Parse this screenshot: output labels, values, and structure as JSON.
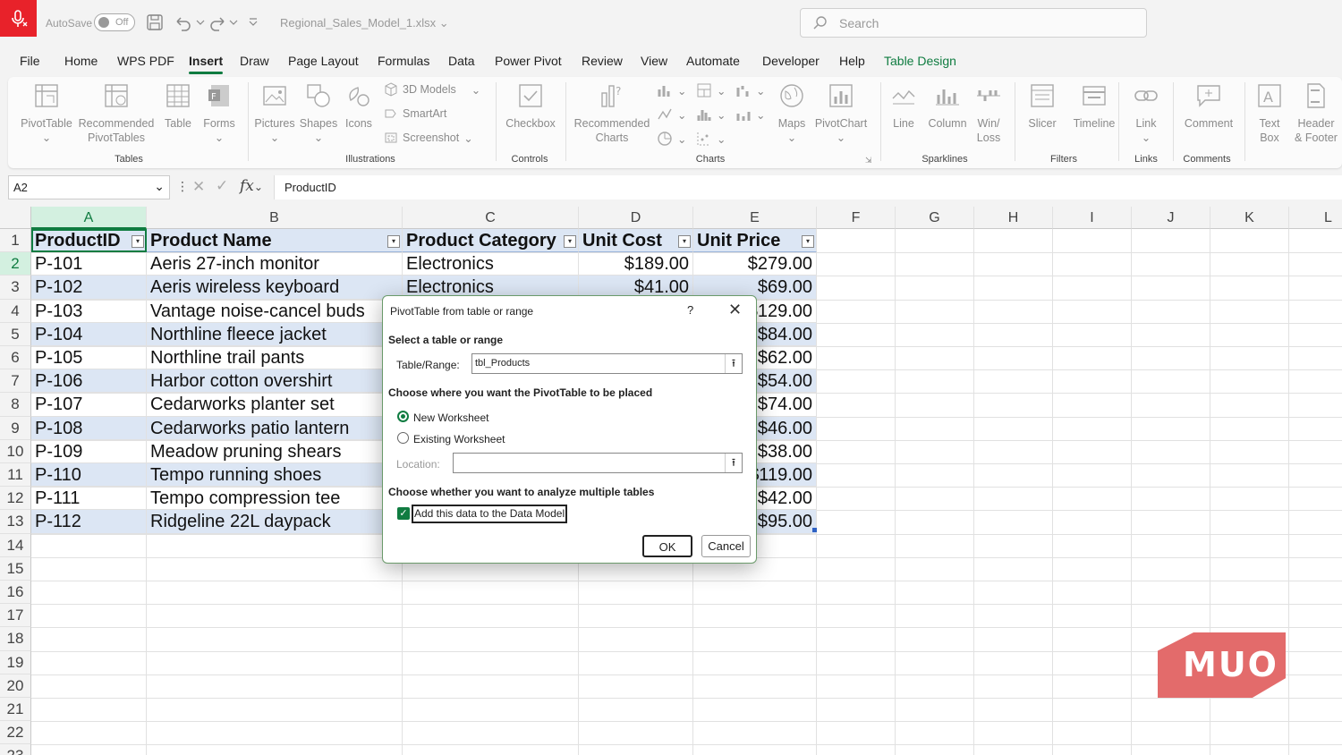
{
  "titlebar": {
    "autosave_label": "AutoSave",
    "autosave_state": "Off",
    "filename": "Regional_Sales_Model_1.xlsx",
    "search_placeholder": "Search"
  },
  "menu": [
    "File",
    "Home",
    "WPS PDF",
    "Insert",
    "Draw",
    "Page Layout",
    "Formulas",
    "Data",
    "Power Pivot",
    "Review",
    "View",
    "Automate",
    "Developer",
    "Help",
    "Table Design"
  ],
  "ribbon": {
    "pivottable": "PivotTable",
    "recommended_pivot": [
      "Recommended",
      "PivotTables"
    ],
    "table": "Table",
    "forms": "Forms",
    "group_tables": "Tables",
    "pictures": "Pictures",
    "shapes": "Shapes",
    "icons": "Icons",
    "models3d": "3D Models",
    "smartart": "SmartArt",
    "screenshot": "Screenshot",
    "group_illustrations": "Illustrations",
    "checkbox": "Checkbox",
    "group_controls": "Controls",
    "recommended_charts": [
      "Recommended",
      "Charts"
    ],
    "maps": "Maps",
    "pivotchart": "PivotChart",
    "group_charts": "Charts",
    "line": "Line",
    "column": "Column",
    "winloss": [
      "Win/",
      "Loss"
    ],
    "group_sparklines": "Sparklines",
    "slicer": "Slicer",
    "timeline": "Timeline",
    "group_filters": "Filters",
    "link": "Link",
    "group_links": "Links",
    "comment": "Comment",
    "group_comments": "Comments",
    "textbox": [
      "Text",
      "Box"
    ],
    "headerfooter": [
      "Header",
      "& Footer"
    ]
  },
  "formula": {
    "namebox": "A2",
    "value": "ProductID"
  },
  "columns": [
    "A",
    "B",
    "C",
    "D",
    "E",
    "F",
    "G",
    "H",
    "I",
    "J",
    "K",
    "L"
  ],
  "rows": [
    "1",
    "2",
    "3",
    "4",
    "5",
    "6",
    "7",
    "8",
    "9",
    "10",
    "11",
    "12",
    "13",
    "14",
    "15",
    "16",
    "17",
    "18",
    "19",
    "20",
    "21",
    "22",
    "23"
  ],
  "table": {
    "headers": [
      "ProductID",
      "Product Name",
      "Product Category",
      "Unit Cost",
      "Unit Price"
    ],
    "data": [
      [
        "P-101",
        "Aeris 27-inch monitor",
        "Electronics",
        "$189.00",
        "$279.00"
      ],
      [
        "P-102",
        "Aeris wireless keyboard",
        "Electronics",
        "$41.00",
        "$69.00"
      ],
      [
        "P-103",
        "Vantage noise-cancel buds",
        "",
        "",
        "$129.00"
      ],
      [
        "P-104",
        "Northline fleece jacket",
        "",
        "",
        "$84.00"
      ],
      [
        "P-105",
        "Northline trail pants",
        "",
        "",
        "$62.00"
      ],
      [
        "P-106",
        "Harbor cotton overshirt",
        "",
        "",
        "$54.00"
      ],
      [
        "P-107",
        "Cedarworks planter set",
        "",
        "",
        "$74.00"
      ],
      [
        "P-108",
        "Cedarworks patio lantern",
        "",
        "",
        "$46.00"
      ],
      [
        "P-109",
        "Meadow pruning shears",
        "",
        "",
        "$38.00"
      ],
      [
        "P-110",
        "Tempo running shoes",
        "",
        "",
        "$119.00"
      ],
      [
        "P-111",
        "Tempo compression tee",
        "",
        "",
        "$42.00"
      ],
      [
        "P-112",
        "Ridgeline 22L daypack",
        "",
        "",
        "$95.00"
      ]
    ]
  },
  "dialog": {
    "title": "PivotTable from table or range",
    "help": "?",
    "close": "✕",
    "section1": "Select a table or range",
    "range_label": "Table/Range:",
    "range_value": "tbl_Products",
    "section2": "Choose where you want the PivotTable to be placed",
    "new_ws": "New Worksheet",
    "existing_ws": "Existing Worksheet",
    "location_label": "Location:",
    "location_value": "",
    "section3": "Choose whether you want to analyze multiple tables",
    "data_model": "Add this data to the Data Model",
    "ok": "OK",
    "cancel": "Cancel"
  },
  "watermark": "MUO",
  "colors": {
    "accent": "#107c41",
    "band": "#dce6f4",
    "logo": "#e36b6b"
  }
}
